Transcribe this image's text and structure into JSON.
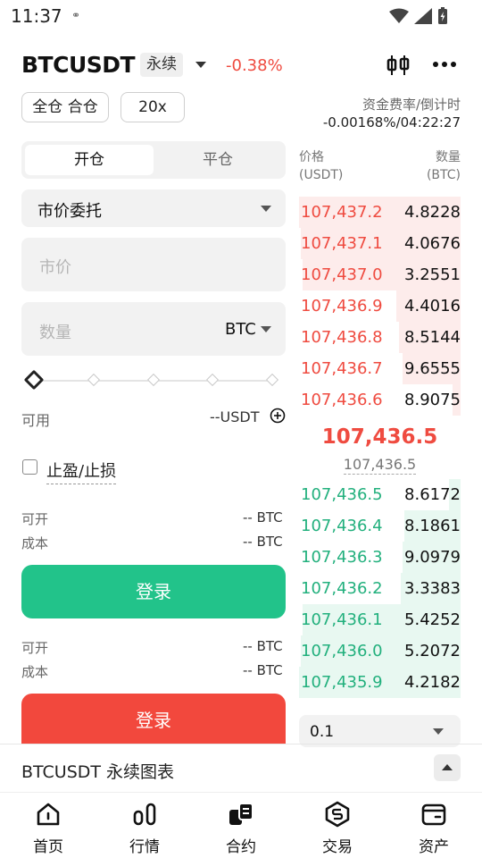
{
  "status_bar": {
    "time": "11:37"
  },
  "header": {
    "symbol": "BTCUSDT",
    "contract_type": "永续",
    "change": "-0.38%",
    "icons": [
      "candlestick-chart-icon",
      "more-icon"
    ]
  },
  "margin": {
    "mode": "全仓 合仓",
    "leverage": "20x"
  },
  "funding": {
    "label": "资金费率/倒计时",
    "value": "-0.00168%/04:22:27"
  },
  "trade_tabs": {
    "open": "开仓",
    "close": "平仓"
  },
  "order_type": "市价委托",
  "price_input": {
    "placeholder": "市价"
  },
  "qty_input": {
    "placeholder": "数量",
    "unit": "BTC"
  },
  "slider": {
    "value_percent": 0
  },
  "available": {
    "label": "可用",
    "value": "--USDT"
  },
  "tpsl": {
    "label": "止盈/止损",
    "checked": false
  },
  "buy_info": {
    "open_label": "可开",
    "open_value": "-- BTC",
    "cost_label": "成本",
    "cost_value": "-- BTC"
  },
  "sell_info": {
    "open_label": "可开",
    "open_value": "-- BTC",
    "cost_label": "成本",
    "cost_value": "-- BTC"
  },
  "buttons": {
    "buy": "登录",
    "sell": "登录"
  },
  "order_book": {
    "price_header": "价格",
    "price_unit": "(USDT)",
    "qty_header": "数量",
    "qty_unit": "(BTC)",
    "asks": [
      {
        "price": "107,437.2",
        "qty": "4.8228",
        "depth": 1.0
      },
      {
        "price": "107,437.1",
        "qty": "4.0676",
        "depth": 0.99
      },
      {
        "price": "107,437.0",
        "qty": "3.2551",
        "depth": 0.98
      },
      {
        "price": "107,436.9",
        "qty": "4.4016",
        "depth": 0.4
      },
      {
        "price": "107,436.8",
        "qty": "8.5144",
        "depth": 0.38
      },
      {
        "price": "107,436.7",
        "qty": "9.6555",
        "depth": 0.36
      },
      {
        "price": "107,436.6",
        "qty": "8.9075",
        "depth": 0.05
      }
    ],
    "last_price": "107,436.5",
    "mark_price": "107,436.5",
    "bids": [
      {
        "price": "107,436.5",
        "qty": "8.6172",
        "depth": 0.07
      },
      {
        "price": "107,436.4",
        "qty": "8.1861",
        "depth": 0.35
      },
      {
        "price": "107,436.3",
        "qty": "9.0979",
        "depth": 0.36
      },
      {
        "price": "107,436.2",
        "qty": "3.3383",
        "depth": 0.37
      },
      {
        "price": "107,436.1",
        "qty": "5.4252",
        "depth": 0.98
      },
      {
        "price": "107,436.0",
        "qty": "5.2072",
        "depth": 0.99
      },
      {
        "price": "107,435.9",
        "qty": "4.2182",
        "depth": 1.0
      }
    ],
    "depth_precision": "0.1"
  },
  "chart_bar": {
    "label": "BTCUSDT 永续图表"
  },
  "bottom_nav": [
    {
      "label": "首页",
      "icon": "home-icon"
    },
    {
      "label": "行情",
      "icon": "markets-icon"
    },
    {
      "label": "合约",
      "icon": "futures-icon"
    },
    {
      "label": "交易",
      "icon": "trade-icon"
    },
    {
      "label": "资产",
      "icon": "wallet-icon"
    }
  ],
  "colors": {
    "up": "#22c38a",
    "down": "#f2483d"
  }
}
